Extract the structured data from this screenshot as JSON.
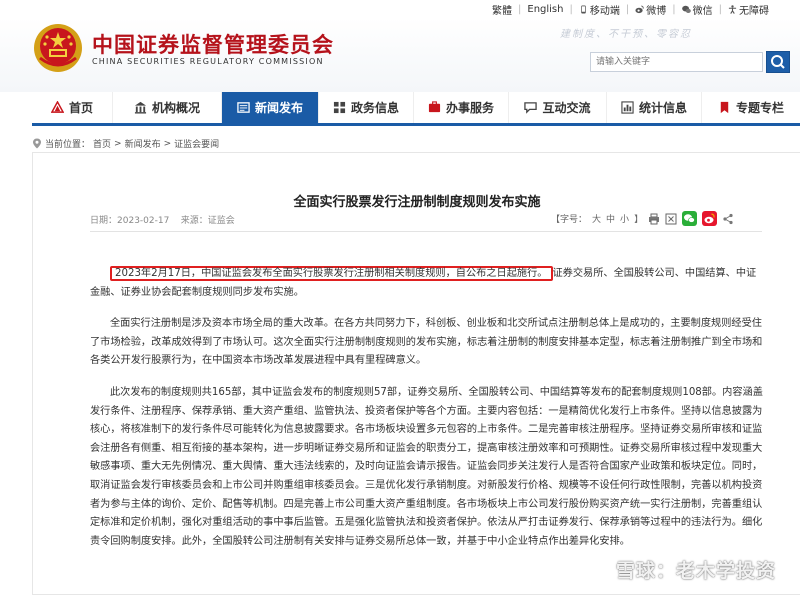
{
  "top_links": {
    "traditional": "繁體",
    "english": "English",
    "mobile": "移动端",
    "weibo": "微博",
    "wechat": "微信",
    "accessibility": "无障碍"
  },
  "header": {
    "title": "中国证券监督管理委员会",
    "subtitle": "CHINA SECURITIES REGULATORY COMMISSION",
    "motto": "建制度、不干预、零容忍",
    "search_placeholder": "请输入关键字"
  },
  "nav": {
    "items": [
      {
        "label": "首页",
        "icon": "home-icon"
      },
      {
        "label": "机构概况",
        "icon": "building-icon"
      },
      {
        "label": "新闻发布",
        "icon": "news-icon"
      },
      {
        "label": "政务信息",
        "icon": "grid-icon"
      },
      {
        "label": "办事服务",
        "icon": "service-icon"
      },
      {
        "label": "互动交流",
        "icon": "chat-icon"
      },
      {
        "label": "统计信息",
        "icon": "chart-icon"
      },
      {
        "label": "专题专栏",
        "icon": "bookmark-icon"
      }
    ],
    "active_index": 2
  },
  "breadcrumb": {
    "prefix": "当前位置：",
    "home": "首页",
    "news": "新闻发布",
    "current": "证监会要闻",
    "sep": ">"
  },
  "article": {
    "title": "全面实行股票发行注册制制度规则发布实施",
    "date_label": "日期：",
    "date": "2023-02-17",
    "source_label": "来源：",
    "source": "证监会",
    "font_label": "【字号：",
    "size_large": "大",
    "size_medium": "中",
    "size_small": "小",
    "font_close": "】",
    "p1_highlight": "2023年2月17日，中国证监会发布全面实行股票发行注册制相关制度规则，自公布之日起施行。",
    "p1_rest": "证券交易所、全国股转公司、中国结算、中证金融、证券业协会配套制度规则同步发布实施。",
    "p2": "全面实行注册制是涉及资本市场全局的重大改革。在各方共同努力下，科创板、创业板和北交所试点注册制总体上是成功的，主要制度规则经受住了市场检验，改革成效得到了市场认可。这次全面实行注册制制度规则的发布实施，标志着注册制的制度安排基本定型，标志着注册制推广到全市场和各类公开发行股票行为，在中国资本市场改革发展进程中具有里程碑意义。",
    "p3": "此次发布的制度规则共165部，其中证监会发布的制度规则57部，证券交易所、全国股转公司、中国结算等发布的配套制度规则108部。内容涵盖发行条件、注册程序、保荐承销、重大资产重组、监管执法、投资者保护等各个方面。主要内容包括：一是精简优化发行上市条件。坚持以信息披露为核心，将核准制下的发行条件尽可能转化为信息披露要求。各市场板块设置多元包容的上市条件。二是完善审核注册程序。坚持证券交易所审核和证监会注册各有侧重、相互衔接的基本架构，进一步明晰证券交易所和证监会的职责分工，提高审核注册效率和可预期性。证券交易所审核过程中发现重大敏感事项、重大无先例情况、重大舆情、重大违法线索的，及时向证监会请示报告。证监会同步关注发行人是否符合国家产业政策和板块定位。同时，取消证监会发行审核委员会和上市公司并购重组审核委员会。三是优化发行承销制度。对新股发行价格、规模等不设任何行政性限制，完善以机构投资者为参与主体的询价、定价、配售等机制。四是完善上市公司重大资产重组制度。各市场板块上市公司发行股份购买资产统一实行注册制，完善重组认定标准和定价机制，强化对重组活动的事中事后监管。五是强化监管执法和投资者保护。依法从严打击证券发行、保荐承销等过程中的违法行为。细化责令回购制度安排。此外，全国股转公司注册制有关安排与证券交易所总体一致，并基于中小企业特点作出差异化安排。"
  },
  "watermark": "雪球：老木学投资"
}
